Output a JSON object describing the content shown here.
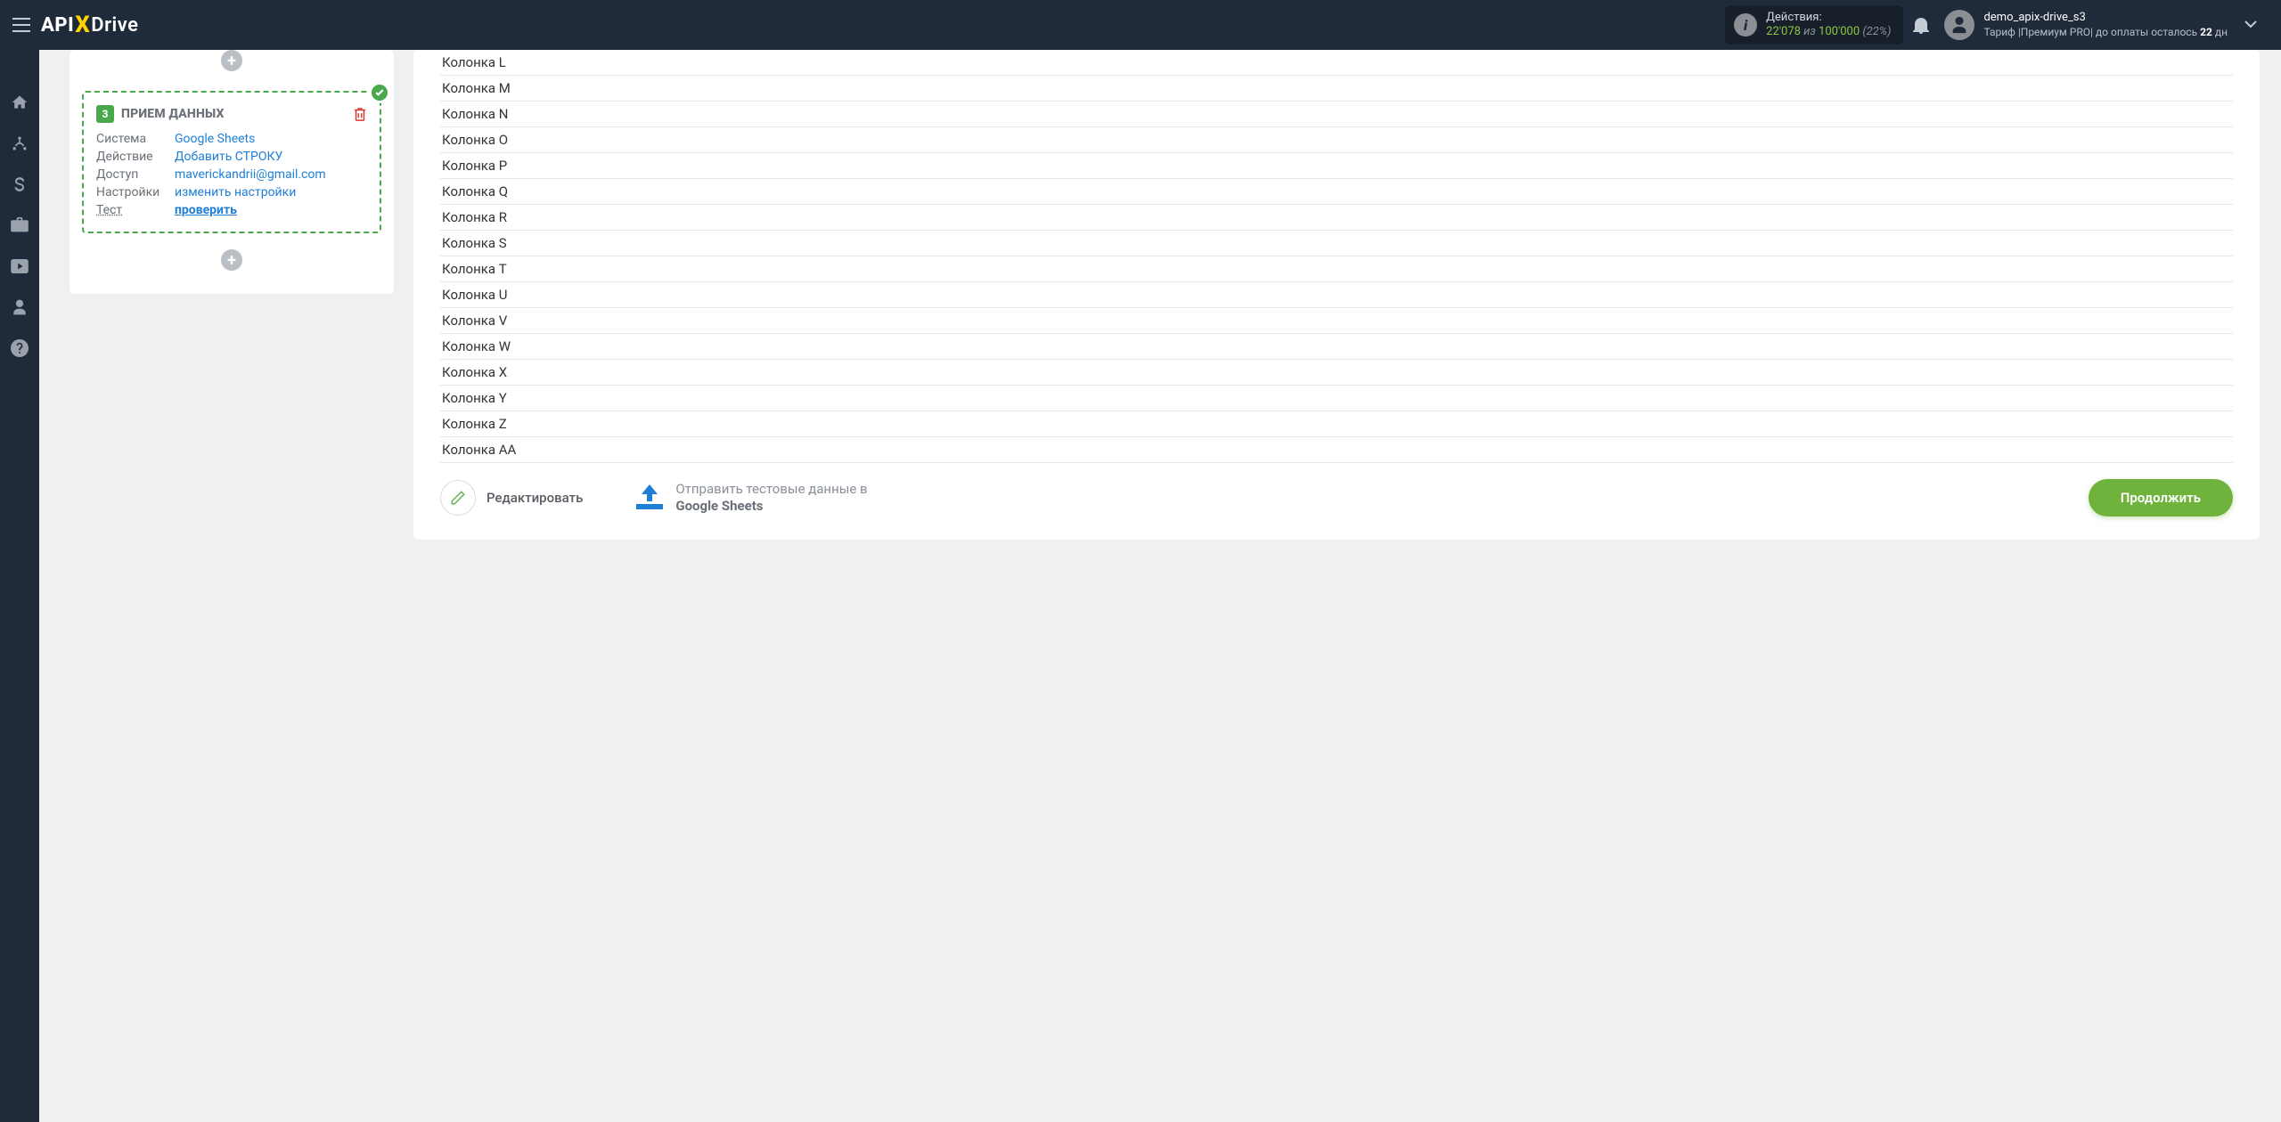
{
  "header": {
    "logo_api": "API",
    "logo_drive": "Drive",
    "actions_label": "Действия:",
    "actions_used": "22'078",
    "actions_iz": " из ",
    "actions_total": "100'000",
    "actions_pct": " (22%)",
    "user_name": "demo_apix-drive_s3",
    "tariff_prefix": "Тариф |Премиум PRO| до оплаты осталось ",
    "tariff_days": "22",
    "tariff_suffix": " дн"
  },
  "sidebar": {
    "items": [
      {
        "name": "home-icon"
      },
      {
        "name": "connections-icon"
      },
      {
        "name": "dollar-icon"
      },
      {
        "name": "briefcase-icon"
      },
      {
        "name": "youtube-icon"
      },
      {
        "name": "user-icon"
      },
      {
        "name": "help-icon"
      }
    ]
  },
  "step": {
    "number": "3",
    "title": "ПРИЕМ ДАННЫХ",
    "rows": {
      "system_k": "Система",
      "system_v": "Google Sheets",
      "action_k": "Действие",
      "action_v": "Добавить СТРОКУ",
      "access_k": "Доступ",
      "access_v": "maverickandrii@gmail.com",
      "settings_k": "Настройки",
      "settings_v": "изменить настройки",
      "test_k": "Тест",
      "test_v": "проверить"
    }
  },
  "columns": [
    "Колонка L",
    "Колонка M",
    "Колонка N",
    "Колонка O",
    "Колонка P",
    "Колонка Q",
    "Колонка R",
    "Колонка S",
    "Колонка T",
    "Колонка U",
    "Колонка V",
    "Колонка W",
    "Колонка X",
    "Колонка Y",
    "Колонка Z",
    "Колонка AA"
  ],
  "actions": {
    "edit": "Редактировать",
    "send_prefix": "Отправить тестовые данные в ",
    "send_bold": "Google Sheets",
    "continue": "Продолжить"
  }
}
